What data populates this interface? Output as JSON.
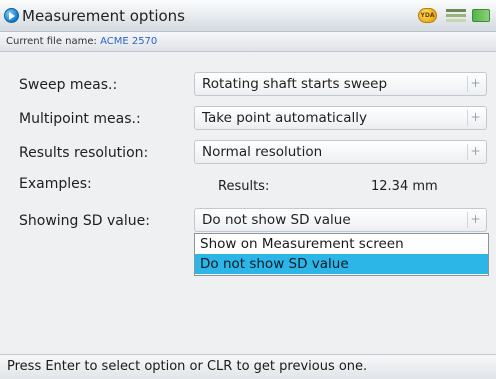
{
  "window": {
    "title": "Measurement options",
    "status_badge": "YDA"
  },
  "file": {
    "label": "Current file name:",
    "name": "ACME 2570"
  },
  "form": {
    "sweep": {
      "label": "Sweep meas.:",
      "value": "Rotating shaft starts sweep"
    },
    "multipoint": {
      "label": "Multipoint meas.:",
      "value": "Take point automatically"
    },
    "resolution": {
      "label": "Results resolution:",
      "value": "Normal resolution"
    },
    "examples": {
      "label": "Examples:",
      "results_label": "Results:",
      "results_value": "12.34 mm"
    },
    "sd": {
      "label": "Showing SD value:",
      "value": "Do not show SD value"
    }
  },
  "dropdown": {
    "options": [
      "Show on Measurement screen",
      "Do not show SD value"
    ],
    "selected_index": 1
  },
  "status_bar": {
    "hint": "Press Enter to select option or CLR to get previous one."
  },
  "icons": {
    "app": "measurement-app-icon",
    "battery": "battery-icon",
    "signal": "signal-icon",
    "spinner": "plus-icon"
  },
  "colors": {
    "highlight": "#2cb6e8",
    "file_name": "#2f63c4",
    "background": "#eef0f2"
  }
}
